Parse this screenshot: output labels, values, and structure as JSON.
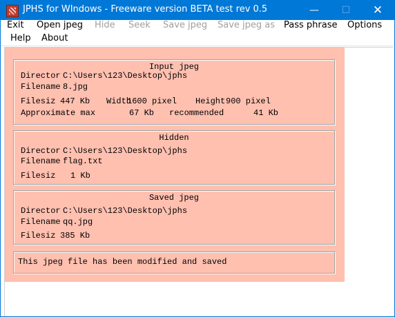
{
  "window": {
    "title": "JPHS for WIndows - Freeware version BETA test rev 0.5",
    "min_glyph": "—",
    "max_glyph": "☐",
    "close_glyph": "✕"
  },
  "menu": {
    "exit": "Exit",
    "open_jpeg": "Open jpeg",
    "hide": "Hide",
    "seek": "Seek",
    "save_jpeg": "Save jpeg",
    "save_jpeg_as": "Save jpeg as",
    "pass_phrase": "Pass phrase",
    "options": "Options",
    "help": "Help",
    "about": "About"
  },
  "input_jpeg": {
    "title": "Input jpeg",
    "directory_label": "Director",
    "directory": "C:\\Users\\123\\Desktop\\jphs",
    "filename_label": "Filename",
    "filename": "8.jpg",
    "filesize_label": "Filesiz",
    "filesize": "447 Kb",
    "width_label": "Width",
    "width": "1600 pixel",
    "height_label": "Height",
    "height": "900 pixel",
    "approx_label": "Approximate max",
    "approx_value": "67 Kb",
    "recommended_label": "recommended",
    "recommended_value": "41 Kb"
  },
  "hidden": {
    "title": "Hidden",
    "directory_label": "Director",
    "directory": "C:\\Users\\123\\Desktop\\jphs",
    "filename_label": "Filename",
    "filename": "flag.txt",
    "filesize_label": "Filesiz",
    "filesize": "1 Kb"
  },
  "saved_jpeg": {
    "title": "Saved jpeg",
    "directory_label": "Director",
    "directory": "C:\\Users\\123\\Desktop\\jphs",
    "filename_label": "Filename",
    "filename": "qq.jpg",
    "filesize_label": "Filesiz",
    "filesize": "385 Kb"
  },
  "status": {
    "message": "This jpeg file has been modified and saved"
  },
  "colors": {
    "titlebar": "#0078d7",
    "panel": "#ffc0b0",
    "disabled_text": "#a0a0a0"
  }
}
